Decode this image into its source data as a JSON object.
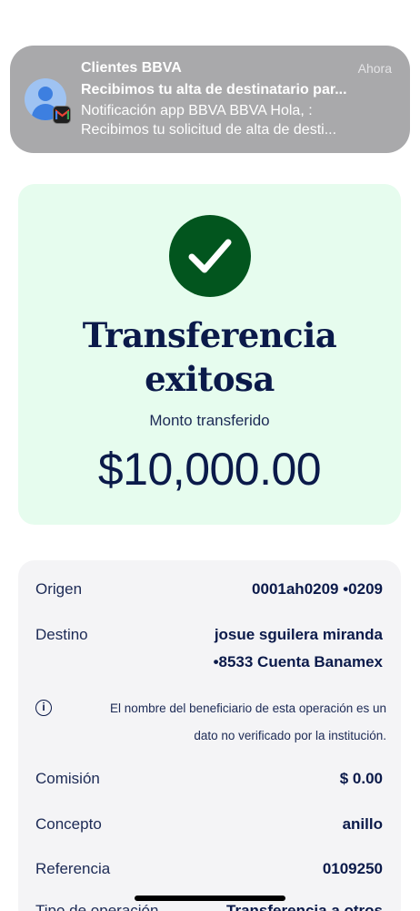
{
  "notification": {
    "app_name": "Clientes BBVA",
    "time": "Ahora",
    "title": "Recibimos tu alta de destinatario par...",
    "body_line1": "Notificación app BBVA BBVA Hola, :",
    "body_line2": "Recibimos tu solicitud de alta de desti...",
    "avatar_icon": "person-avatar-icon",
    "badge_icon": "gmail-icon"
  },
  "success": {
    "icon": "checkmark-icon",
    "icon_color": "#02551e",
    "card_color": "#e6fcee",
    "title_line1": "Transferencia",
    "title_line2": "exitosa",
    "amount_label": "Monto transferido",
    "amount": "$10,000.00"
  },
  "details": {
    "origin_label": "Origen",
    "origin_value": "0001ah0209 •0209",
    "destination_label": "Destino",
    "destination_line1": "josue sguilera miranda",
    "destination_line2": "•8533 Cuenta Banamex",
    "info_icon": "info-icon",
    "info_line1": "El nombre del beneficiario de esta operación es un",
    "info_line2": "dato no verificado por la institución.",
    "commission_label": "Comisión",
    "commission_value": "$ 0.00",
    "concept_label": "Concepto",
    "concept_value": "anillo",
    "reference_label": "Referencia",
    "reference_value": "0109250",
    "type_label": "Tipo de operación",
    "type_value": "Transferencia a otros"
  }
}
